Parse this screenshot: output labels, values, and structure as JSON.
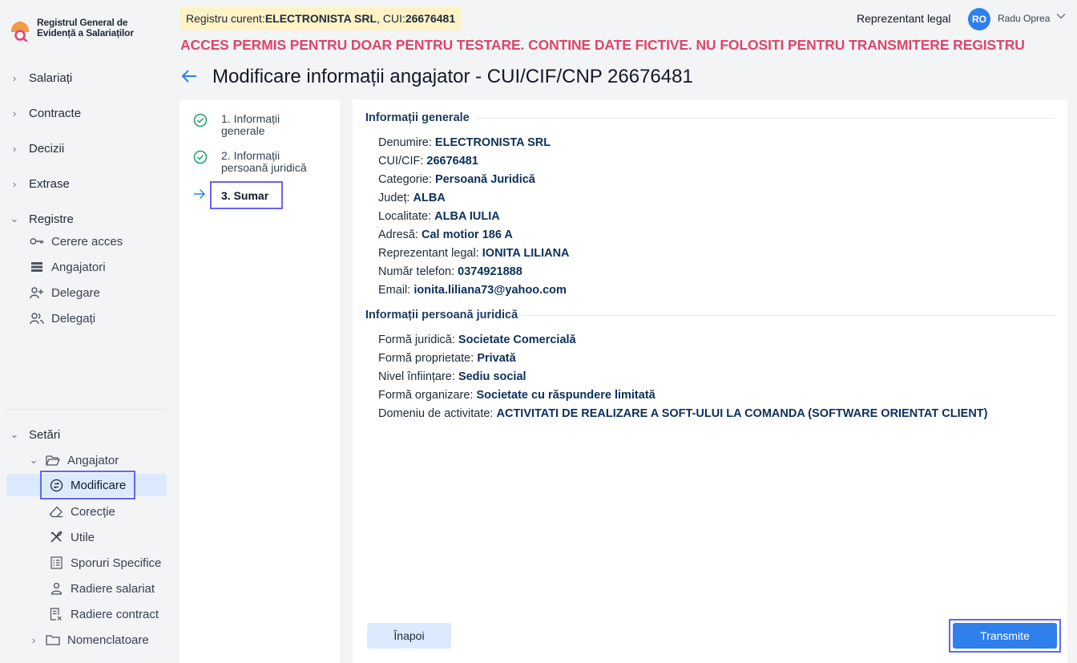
{
  "app": {
    "logo_line1": "Registrul General de",
    "logo_line2": "Evidență a Salariaților"
  },
  "sidebar": {
    "sections": [
      {
        "label": "Salariați"
      },
      {
        "label": "Contracte"
      },
      {
        "label": "Decizii"
      },
      {
        "label": "Extrase"
      },
      {
        "label": "Registre"
      }
    ],
    "registre_items": [
      {
        "label": "Cerere acces"
      },
      {
        "label": "Angajatori"
      },
      {
        "label": "Delegare"
      },
      {
        "label": "Delegați"
      }
    ],
    "settings": {
      "label": "Setări"
    },
    "angajator": {
      "label": "Angajator"
    },
    "angajator_items": [
      {
        "label": "Modificare"
      },
      {
        "label": "Corecție"
      },
      {
        "label": "Utile"
      },
      {
        "label": "Sporuri Specifice"
      },
      {
        "label": "Radiere salariat"
      },
      {
        "label": "Radiere contract"
      }
    ],
    "nomenclatoare": {
      "label": "Nomenclatoare"
    }
  },
  "header": {
    "registry_prefix": "Registru curent: ",
    "registry_name": "ELECTRONISTA SRL",
    "registry_cui_prefix": ", CUI: ",
    "registry_cui": "26676481",
    "role": "Reprezentant legal",
    "avatar_initials": "RO",
    "user_name": "Radu Oprea",
    "warning": "ACCES PERMIS PENTRU DOAR PENTRU TESTARE. CONTINE DATE FICTIVE. NU FOLOSITI PENTRU TRANSMITERE REGISTRU"
  },
  "page": {
    "title": "Modificare informații angajator - CUI/CIF/CNP 26676481"
  },
  "steps": [
    {
      "line1": "1. Informații",
      "line2": "generale",
      "status": "done"
    },
    {
      "line1": "2. Informații",
      "line2": "persoană juridică",
      "status": "done"
    },
    {
      "line1": "3. Sumar",
      "status": "current"
    }
  ],
  "summary": {
    "general_title": "Informații generale",
    "general": [
      {
        "label": "Denumire: ",
        "value": "ELECTRONISTA SRL"
      },
      {
        "label": "CUI/CIF: ",
        "value": "26676481"
      },
      {
        "label": "Categorie: ",
        "value": "Persoană Juridică"
      },
      {
        "label": "Județ: ",
        "value": "ALBA"
      },
      {
        "label": "Localitate: ",
        "value": "ALBA IULIA"
      },
      {
        "label": "Adresă: ",
        "value": "Cal motior 186 A"
      },
      {
        "label": "Reprezentant legal: ",
        "value": "IONITA LILIANA"
      },
      {
        "label": "Număr telefon: ",
        "value": "0374921888"
      },
      {
        "label": "Email: ",
        "value": "ionita.liliana73@yahoo.com"
      }
    ],
    "legal_title": "Informații persoană juridică",
    "legal": [
      {
        "label": "Formă juridică: ",
        "value": "Societate Comercială"
      },
      {
        "label": "Formă proprietate: ",
        "value": "Privată"
      },
      {
        "label": "Nivel înființare: ",
        "value": "Sediu social"
      },
      {
        "label": "Formă organizare: ",
        "value": "Societate cu răspundere limitată"
      },
      {
        "label": "Domeniu de activitate: ",
        "value": "ACTIVITATI DE REALIZARE A SOFT-ULUI LA COMANDA (SOFTWARE ORIENTAT CLIENT)"
      }
    ]
  },
  "actions": {
    "back_label": "Înapoi",
    "submit_label": "Transmite"
  },
  "colors": {
    "accent": "#2f80ed",
    "warning": "#e0456b",
    "highlight": "#6366f1",
    "value_text": "#0c2f5c"
  }
}
